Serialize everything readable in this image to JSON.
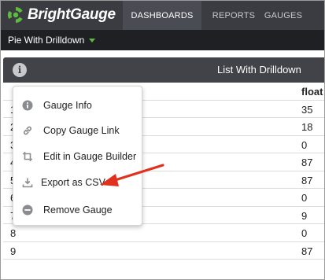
{
  "app": {
    "brand": "BrightGauge",
    "accent": "#5dbb3f"
  },
  "nav": {
    "dashboards": "DASHBOARDS",
    "reports": "REPORTS",
    "gauges": "GAUGES"
  },
  "dashboard": {
    "title": "Pie With Drilldown"
  },
  "gauge": {
    "title": "List With Drilldown",
    "info_icon": "info-icon"
  },
  "table": {
    "columns": [
      "",
      "float"
    ],
    "rows": [
      {
        "id": "1",
        "float": "35"
      },
      {
        "id": "2",
        "float": "18"
      },
      {
        "id": "3",
        "float": "0"
      },
      {
        "id": "4",
        "float": "87"
      },
      {
        "id": "5",
        "float": "87"
      },
      {
        "id": "6",
        "float": "0"
      },
      {
        "id": "7",
        "float": "9"
      },
      {
        "id": "8",
        "float": "0"
      },
      {
        "id": "9",
        "float": "87"
      }
    ]
  },
  "menu": {
    "items": [
      {
        "label": "Gauge Info",
        "icon": "info-circle-icon"
      },
      {
        "label": "Copy Gauge Link",
        "icon": "link-icon"
      },
      {
        "label": "Edit in Gauge Builder",
        "icon": "crop-icon"
      },
      {
        "label": "Export as CSV",
        "icon": "download-icon"
      },
      {
        "label": "Remove Gauge",
        "icon": "minus-circle-icon"
      }
    ]
  },
  "annotation": {
    "arrow_color": "#e0301e"
  }
}
